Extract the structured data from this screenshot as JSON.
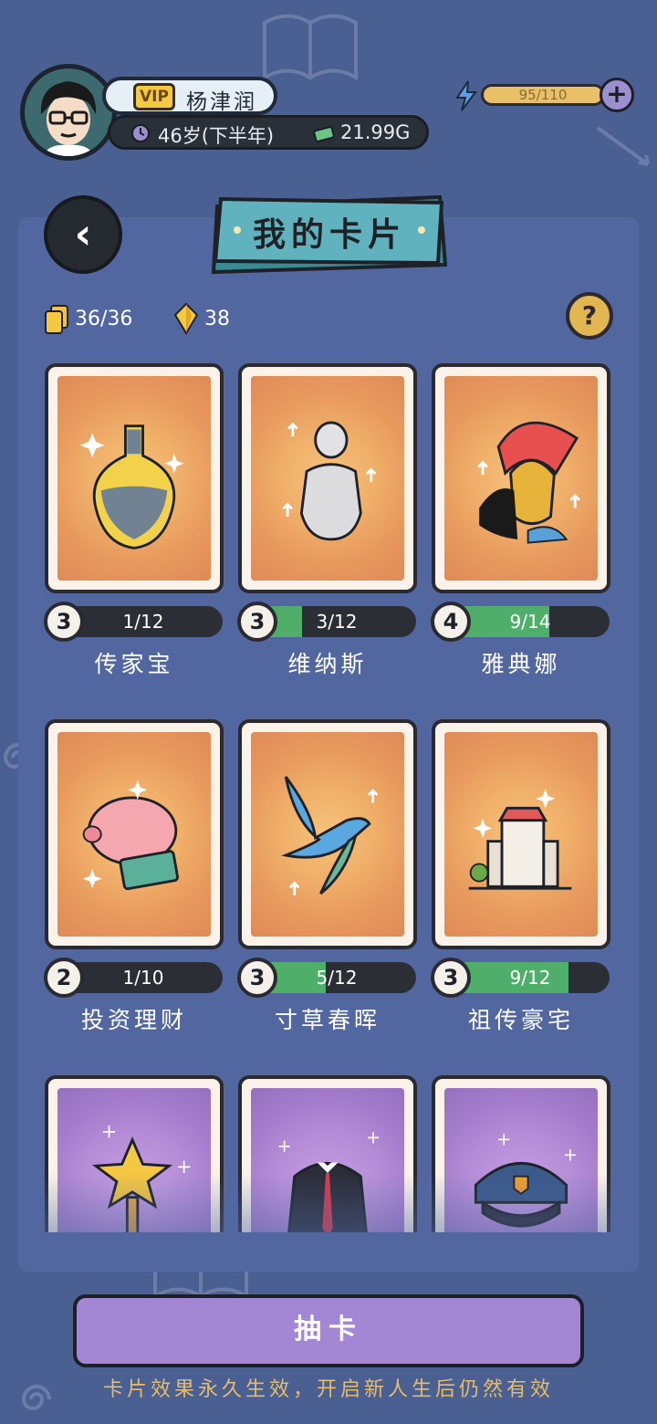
{
  "profile": {
    "vip_label": "VIP",
    "name": "杨津润",
    "age": "46岁(下半年)",
    "money": "21.99G"
  },
  "energy": {
    "value": "95/110",
    "fill_fraction": 0.86
  },
  "page_title": "我的卡片",
  "counts": {
    "cards": "36/36",
    "gems": "38"
  },
  "cards": [
    {
      "name": "传家宝",
      "level": "3",
      "progress": "1/12",
      "fill_fraction": 0.0
    },
    {
      "name": "维纳斯",
      "level": "3",
      "progress": "3/12",
      "fill_fraction": 0.2
    },
    {
      "name": "雅典娜",
      "level": "4",
      "progress": "9/14",
      "fill_fraction": 0.55
    },
    {
      "name": "投资理财",
      "level": "2",
      "progress": "1/10",
      "fill_fraction": 0.0
    },
    {
      "name": "寸草春晖",
      "level": "3",
      "progress": "5/12",
      "fill_fraction": 0.35
    },
    {
      "name": "祖传豪宅",
      "level": "3",
      "progress": "9/12",
      "fill_fraction": 0.67
    }
  ],
  "draw_button": "抽卡",
  "footer_note": "卡片效果永久生效，开启新人生后仍然有效",
  "colors": {
    "background": "#4a5f92",
    "panel": "#5267a0",
    "progress_fill": "#4fae6a",
    "card_orange": "#e89a5e",
    "card_purple": "#b68ed8",
    "draw_button": "#a387d4",
    "footer_text": "#e8bd6a"
  },
  "icons": [
    "stack-of-cards-icon",
    "gem-icon",
    "help-icon",
    "back-arrow-icon",
    "lightning-icon",
    "plus-icon",
    "clock-icon",
    "money-icon"
  ]
}
